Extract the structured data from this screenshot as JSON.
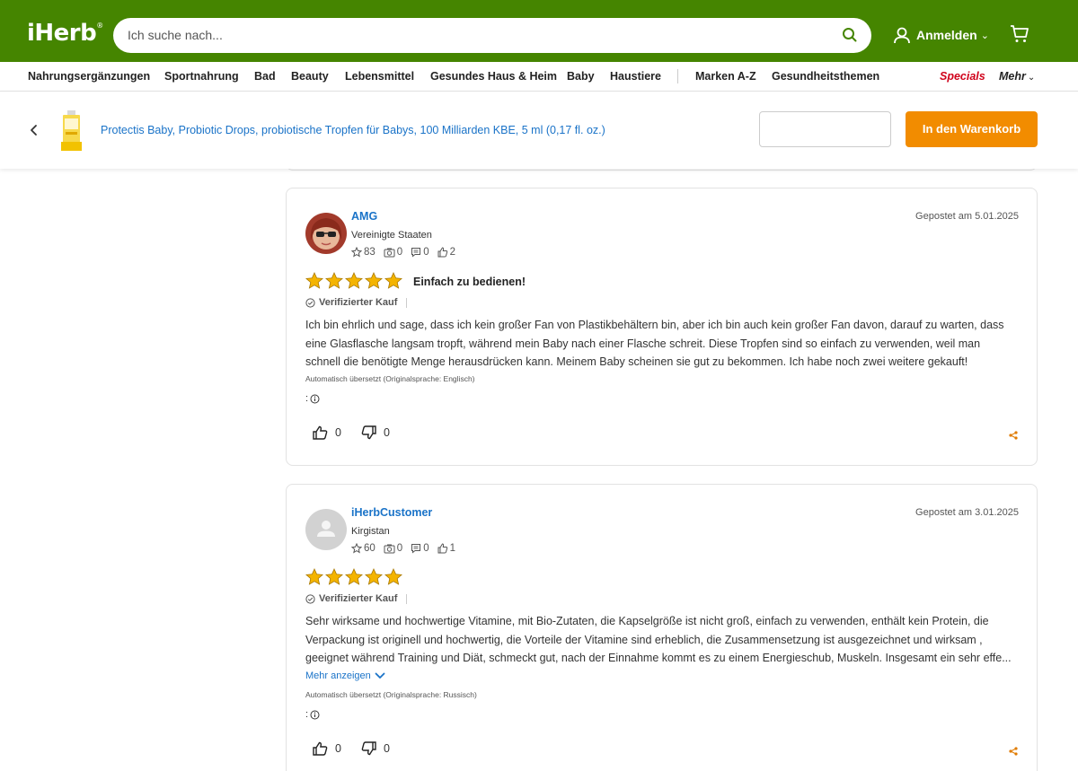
{
  "header": {
    "logo": "iHerb",
    "search_placeholder": "Ich suche nach...",
    "account_label": "Anmelden",
    "brand_color": "#458500"
  },
  "nav": {
    "items": [
      "Nahrungsergänzungen",
      "Sportnahrung",
      "Bad",
      "Beauty",
      "Lebensmittel",
      "Gesundes Haus & Heim",
      "Baby",
      "Haustiere",
      "Marken A-Z",
      "Gesundheitsthemen"
    ],
    "specials": "Specials",
    "more": "Mehr"
  },
  "product_bar": {
    "title": "Protectis Baby, Probiotic Drops, probiotische Tropfen für Babys, 100 Milliarden KBE, 5 ml (0,17 fl. oz.)",
    "quantity_value": "",
    "add_to_cart_label": "In den Warenkorb",
    "button_color": "#f28c00"
  },
  "reviews": [
    {
      "username": "AMG",
      "country": "Vereinigte Staaten",
      "stats": {
        "stars": "83",
        "photos": "0",
        "reviews": "0",
        "helpful": "2"
      },
      "posted": "Gepostet am 5.01.2025",
      "rating": 5,
      "title": "Einfach zu bedienen!",
      "verified": "Verifizierter Kauf",
      "text": "Ich bin ehrlich und sage, dass ich kein großer Fan von Plastikbehältern bin, aber ich bin auch kein großer Fan davon, darauf zu warten, dass eine Glasflasche langsam tropft, während mein Baby nach einer Flasche schreit. Diese Tropfen sind so einfach zu verwenden, weil man schnell die benötigte Menge herausdrücken kann. Meinem Baby scheinen sie gut zu bekommen. Ich habe noch zwei weitere gekauft!",
      "translated_note": "Automatisch übersetzt (Originalsprache: Englisch)",
      "info_prefix": ":",
      "likes": "0",
      "dislikes": "0"
    },
    {
      "username": "iHerbCustomer",
      "country": "Kirgistan",
      "stats": {
        "stars": "60",
        "photos": "0",
        "reviews": "0",
        "helpful": "1"
      },
      "posted": "Gepostet am 3.01.2025",
      "rating": 5,
      "verified": "Verifizierter Kauf",
      "text": "Sehr wirksame und hochwertige Vitamine, mit Bio-Zutaten, die Kapselgröße ist nicht groß, einfach zu verwenden, enthält kein Protein, die Verpackung ist originell und hochwertig, die Vorteile der Vitamine sind erheblich, die Zusammensetzung ist ausgezeichnet und wirksam , geeignet während Training und Diät, schmeckt gut, nach der Einnahme kommt es zu einem Energieschub, Muskeln. Insgesamt ein sehr effe...",
      "show_more": "Mehr anzeigen",
      "translated_note": "Automatisch übersetzt (Originalsprache: Russisch)",
      "info_prefix": ":",
      "likes": "0",
      "dislikes": "0"
    }
  ]
}
